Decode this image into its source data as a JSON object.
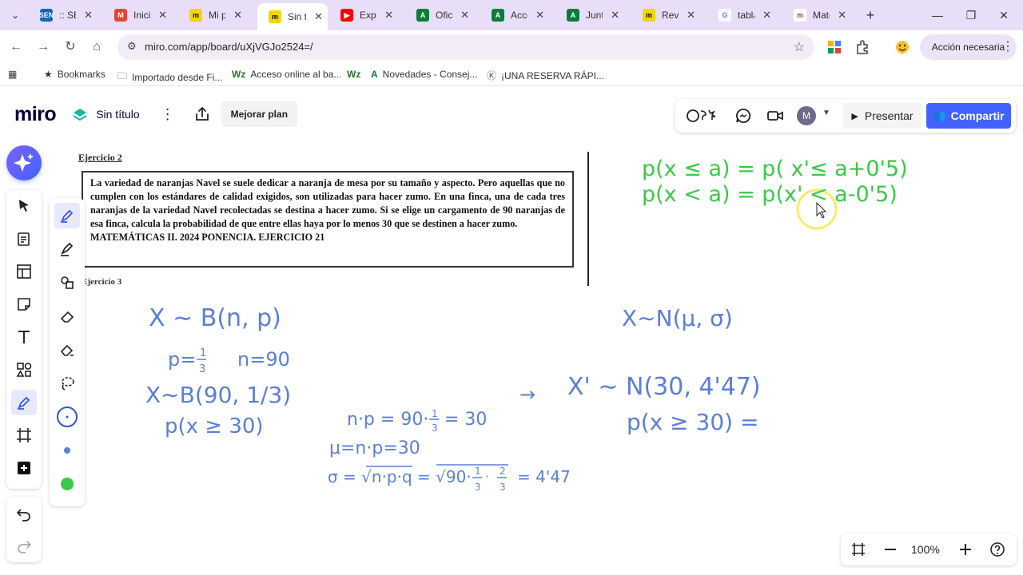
{
  "browser": {
    "tabs": [
      {
        "title": ":: SEN",
        "icon": "sen-favicon",
        "color": "#1565c0",
        "glyph": "SEN"
      },
      {
        "title": "Iniciar",
        "icon": "gmail-favicon",
        "color": "#ea4335",
        "glyph": "M"
      },
      {
        "title": "Mi pr",
        "icon": "miro-favicon",
        "color": "#f2d600",
        "glyph": "m"
      },
      {
        "title": "Sin tít",
        "icon": "miro-favicon",
        "color": "#f2d600",
        "glyph": "m",
        "active": true
      },
      {
        "title": "Exper",
        "icon": "youtube-favicon",
        "color": "#ff0000",
        "glyph": "▶"
      },
      {
        "title": "Oficin",
        "icon": "a-favicon",
        "color": "#0a7d3b",
        "glyph": "A"
      },
      {
        "title": "Acces",
        "icon": "a-favicon",
        "color": "#0a7d3b",
        "glyph": "A"
      },
      {
        "title": "Junta",
        "icon": "a-favicon",
        "color": "#0a7d3b",
        "glyph": "A"
      },
      {
        "title": "Revis",
        "icon": "miro-favicon",
        "color": "#f2d600",
        "glyph": "m"
      },
      {
        "title": "tabla",
        "icon": "google-favicon",
        "color": "#ffffff",
        "glyph": "G"
      },
      {
        "title": "Mate",
        "icon": "m-favicon",
        "color": "#ffffff",
        "glyph": "m"
      }
    ],
    "url": "miro.com/app/board/uXjVGJo2524=/",
    "action_needed": "Acción necesaria",
    "bookmarks": [
      {
        "label": "Bookmarks",
        "icon": "star-icon"
      },
      {
        "label": "Importado desde Fi...",
        "icon": "folder-icon"
      },
      {
        "label": "Acceso online al ba...",
        "icon": "wz-icon"
      },
      {
        "label": "",
        "icon": "wz-icon"
      },
      {
        "label": "Novedades - Consej...",
        "icon": "a-icon"
      },
      {
        "label": "¡UNA RESERVA RÁPI...",
        "icon": "k-icon"
      }
    ]
  },
  "miro": {
    "logo": "miro",
    "board_title": "Sin título",
    "upgrade": "Mejorar plan",
    "present": "Presentar",
    "share": "Compartir",
    "avatar": "M",
    "zoom": "100%"
  },
  "exercise": {
    "heading": "Ejercicio 2",
    "body": "La variedad de naranjas Navel se suele dedicar a naranja de mesa por su tamaño y aspecto. Pero aquellas que no cumplen con los estándares de calidad exigidos, son utilizadas para hacer zumo. En una finca, una de cada tres naranjas de la variedad Navel recolectadas se destina a hacer zumo. Si se elige un cargamento de 90 naranjas de esa finca, calcula la probabilidad de que entre ellas haya por lo menos 30 que se destinen a hacer zumo.",
    "source": "MATEMÁTICAS II. 2024 PONENCIA. EJERCICIO 21",
    "next_heading": "Ejercicio 3"
  },
  "colors": {
    "ink_blue": "#5b7fd6",
    "ink_green": "#3cc84a",
    "miro_blue": "#4262ff",
    "cursor_highlight": "#f5e642"
  }
}
